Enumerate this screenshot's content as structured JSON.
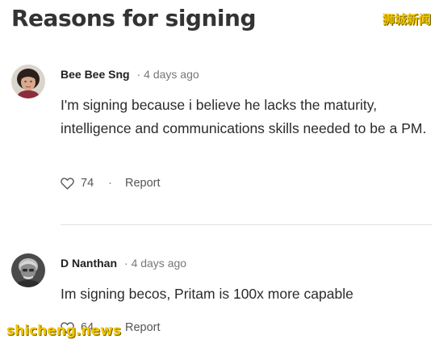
{
  "section": {
    "title": "Reasons for signing"
  },
  "watermarks": {
    "top": "狮城新闻",
    "bottom": "shicheng.news"
  },
  "comments": [
    {
      "author": "Bee Bee Sng",
      "separator": "·",
      "time": "4 days ago",
      "text": "I'm signing because i believe he lacks the maturity, intelligence and communications skills needed to be a PM.",
      "likes": "74",
      "action_separator": "·",
      "report_label": "Report"
    },
    {
      "author": "D Nanthan",
      "separator": "·",
      "time": "4 days ago",
      "text": "Im signing becos, Pritam is 100x more capable",
      "likes": "64",
      "action_separator": "·",
      "report_label": "Report"
    }
  ],
  "icons": {
    "like": "heart-icon"
  },
  "colors": {
    "watermark": "#f3c600",
    "divider": "#e0e0e0",
    "text": "#212121",
    "muted": "#777777"
  }
}
